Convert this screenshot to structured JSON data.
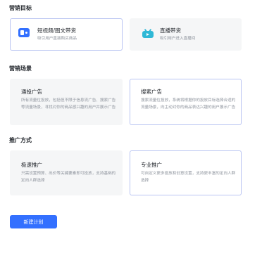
{
  "marketing_goal": {
    "title": "营销目标",
    "options": [
      {
        "label": "短视频/图文带货",
        "desc": "吸引用户直接购买商品",
        "icon": "short-video-icon",
        "selected": true
      },
      {
        "label": "直播带货",
        "desc": "吸引用户进入直播间",
        "icon": "live-tv-icon",
        "selected": false
      }
    ]
  },
  "marketing_scene": {
    "title": "营销场景",
    "options": [
      {
        "label": "通投广告",
        "desc": "所有流量位投放，包括但不限于信息流广告、搜索广告等流量场景，寻找对你的商品感兴趣的用户并展示广告",
        "selected": false
      },
      {
        "label": "搜索广告",
        "desc": "搜索流量位投放，系统将根据你的投放目标选择合适的流量场景，向主动对你的商品表达兴趣的用户展示广告",
        "selected": true
      }
    ]
  },
  "promotion_method": {
    "title": "推广方式",
    "options": [
      {
        "label": "极速推广",
        "desc": "只需设置预算、出价等关键要素即可投放，支持基础的定向人群选择",
        "selected": false
      },
      {
        "label": "专业推广",
        "desc": "可自定义更多投放和创意设置，支持更丰富的定向人群选择",
        "selected": true
      }
    ]
  },
  "actions": {
    "new_plan_label": "新建计划"
  },
  "colors": {
    "primary": "#3370ff",
    "selected_border": "#b9c4f2",
    "card_bg": "#f5f6f7",
    "tv_icon": "#2fb8d6"
  }
}
